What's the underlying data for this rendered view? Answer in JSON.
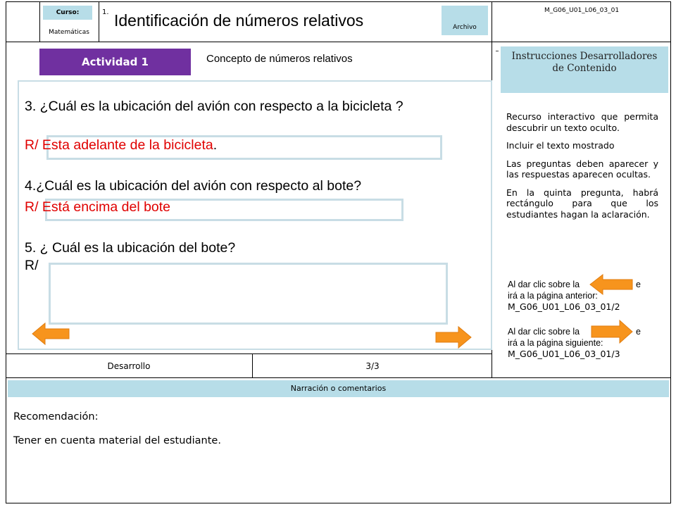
{
  "header": {
    "curso_label": "Curso:",
    "curso_value": "Matemáticas",
    "number": "1.",
    "title": "Identificación de números relativos",
    "archivo_label": "Archivo",
    "code": "M_G06_U01_L06_03_01"
  },
  "activity": {
    "badge": "Actividad 1",
    "subtitle": "Concepto de números relativos",
    "q3": "3. ¿Cuál es la ubicación del avión con respecto a la bicicleta ?",
    "a3_prefix": "R/",
    "a3": "Esta adelante de la bicicleta",
    "a3_suffix": ".",
    "q4": "4.¿Cuál es la ubicación del avión con respecto al bote?",
    "a4_prefix": "R/",
    "a4": "Está encima del bote",
    "q5": "5. ¿ Cuál es la ubicación del bote?",
    "a5_prefix": "R/"
  },
  "instructions": {
    "title": "Instrucciones Desarrolladores de Contenido",
    "p1": "Recurso interactivo que permita descubrir un texto oculto.",
    "p2": "Incluir el texto mostrado",
    "p3": "Las preguntas deben aparecer y las respuestas aparecen ocultas.",
    "p4": "En la quinta pregunta, habrá rectángulo para que los estudiantes hagan la aclaración.",
    "prev_line1": "Al dar clic sobre la",
    "prev_line1_end": "e",
    "prev_line2": "irá a la página anterior:",
    "prev_code": "M_G06_U01_L06_03_01/2",
    "next_line1": "Al dar clic sobre la",
    "next_line1_end": "e",
    "next_line2": "irá a la página siguiente:",
    "next_code": "M_G06_U01_L06_03_01/3"
  },
  "footer": {
    "section": "Desarrollo",
    "page": "3/3"
  },
  "narration": {
    "header": "Narración o comentarios",
    "label": "Recomendación:",
    "text": "Tener en cuenta material del estudiante."
  },
  "colors": {
    "badge": "#7030a0",
    "teal": "#b7dde8",
    "red": "#e00000",
    "arrow": "#f7941d",
    "box_border": "#c8dde5"
  }
}
